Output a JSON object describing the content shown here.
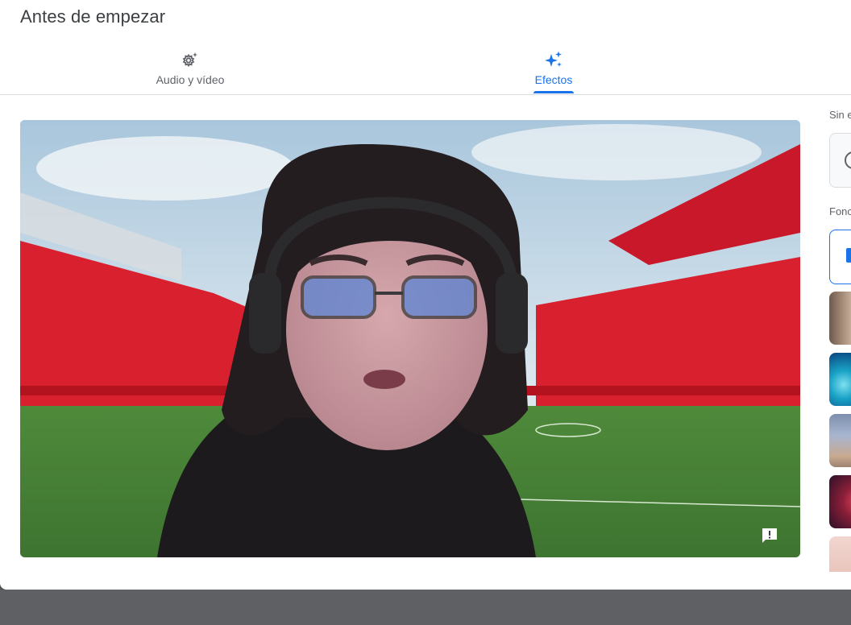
{
  "dialog": {
    "title": "Antes de empezar"
  },
  "tabs": [
    {
      "label": "Audio y vídeo",
      "icon": "settings-sparkle-icon",
      "selected": false
    },
    {
      "label": "Efectos",
      "icon": "sparkle-icon",
      "selected": true
    }
  ],
  "sidebar": {
    "no_effects_label": "Sin e",
    "backgrounds_label": "Fonc"
  },
  "colors": {
    "accent": "#1a73e8",
    "text_secondary": "#5f6368",
    "backdrop": "#5f6063"
  }
}
